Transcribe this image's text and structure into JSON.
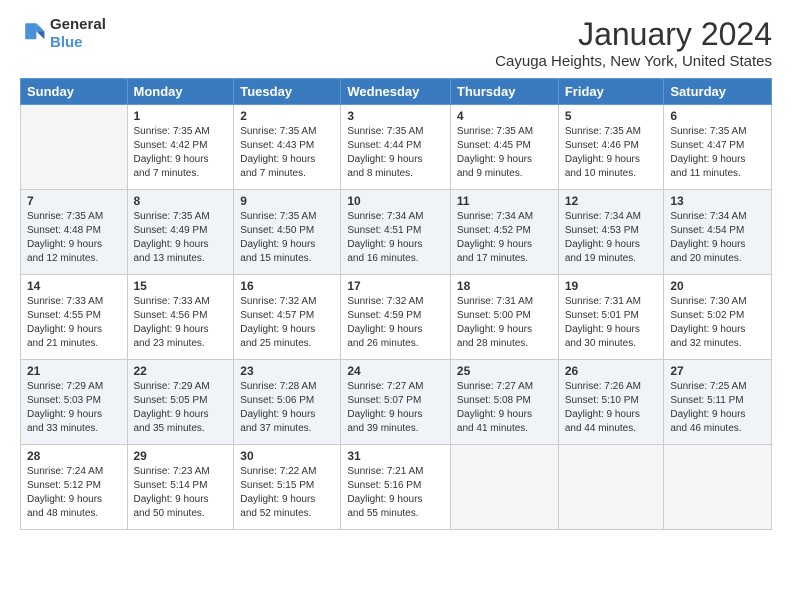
{
  "header": {
    "logo_line1": "General",
    "logo_line2": "Blue",
    "title": "January 2024",
    "subtitle": "Cayuga Heights, New York, United States"
  },
  "weekdays": [
    "Sunday",
    "Monday",
    "Tuesday",
    "Wednesday",
    "Thursday",
    "Friday",
    "Saturday"
  ],
  "weeks": [
    [
      {
        "day": "",
        "info": ""
      },
      {
        "day": "1",
        "info": "Sunrise: 7:35 AM\nSunset: 4:42 PM\nDaylight: 9 hours\nand 7 minutes."
      },
      {
        "day": "2",
        "info": "Sunrise: 7:35 AM\nSunset: 4:43 PM\nDaylight: 9 hours\nand 7 minutes."
      },
      {
        "day": "3",
        "info": "Sunrise: 7:35 AM\nSunset: 4:44 PM\nDaylight: 9 hours\nand 8 minutes."
      },
      {
        "day": "4",
        "info": "Sunrise: 7:35 AM\nSunset: 4:45 PM\nDaylight: 9 hours\nand 9 minutes."
      },
      {
        "day": "5",
        "info": "Sunrise: 7:35 AM\nSunset: 4:46 PM\nDaylight: 9 hours\nand 10 minutes."
      },
      {
        "day": "6",
        "info": "Sunrise: 7:35 AM\nSunset: 4:47 PM\nDaylight: 9 hours\nand 11 minutes."
      }
    ],
    [
      {
        "day": "7",
        "info": "Sunrise: 7:35 AM\nSunset: 4:48 PM\nDaylight: 9 hours\nand 12 minutes."
      },
      {
        "day": "8",
        "info": "Sunrise: 7:35 AM\nSunset: 4:49 PM\nDaylight: 9 hours\nand 13 minutes."
      },
      {
        "day": "9",
        "info": "Sunrise: 7:35 AM\nSunset: 4:50 PM\nDaylight: 9 hours\nand 15 minutes."
      },
      {
        "day": "10",
        "info": "Sunrise: 7:34 AM\nSunset: 4:51 PM\nDaylight: 9 hours\nand 16 minutes."
      },
      {
        "day": "11",
        "info": "Sunrise: 7:34 AM\nSunset: 4:52 PM\nDaylight: 9 hours\nand 17 minutes."
      },
      {
        "day": "12",
        "info": "Sunrise: 7:34 AM\nSunset: 4:53 PM\nDaylight: 9 hours\nand 19 minutes."
      },
      {
        "day": "13",
        "info": "Sunrise: 7:34 AM\nSunset: 4:54 PM\nDaylight: 9 hours\nand 20 minutes."
      }
    ],
    [
      {
        "day": "14",
        "info": "Sunrise: 7:33 AM\nSunset: 4:55 PM\nDaylight: 9 hours\nand 21 minutes."
      },
      {
        "day": "15",
        "info": "Sunrise: 7:33 AM\nSunset: 4:56 PM\nDaylight: 9 hours\nand 23 minutes."
      },
      {
        "day": "16",
        "info": "Sunrise: 7:32 AM\nSunset: 4:57 PM\nDaylight: 9 hours\nand 25 minutes."
      },
      {
        "day": "17",
        "info": "Sunrise: 7:32 AM\nSunset: 4:59 PM\nDaylight: 9 hours\nand 26 minutes."
      },
      {
        "day": "18",
        "info": "Sunrise: 7:31 AM\nSunset: 5:00 PM\nDaylight: 9 hours\nand 28 minutes."
      },
      {
        "day": "19",
        "info": "Sunrise: 7:31 AM\nSunset: 5:01 PM\nDaylight: 9 hours\nand 30 minutes."
      },
      {
        "day": "20",
        "info": "Sunrise: 7:30 AM\nSunset: 5:02 PM\nDaylight: 9 hours\nand 32 minutes."
      }
    ],
    [
      {
        "day": "21",
        "info": "Sunrise: 7:29 AM\nSunset: 5:03 PM\nDaylight: 9 hours\nand 33 minutes."
      },
      {
        "day": "22",
        "info": "Sunrise: 7:29 AM\nSunset: 5:05 PM\nDaylight: 9 hours\nand 35 minutes."
      },
      {
        "day": "23",
        "info": "Sunrise: 7:28 AM\nSunset: 5:06 PM\nDaylight: 9 hours\nand 37 minutes."
      },
      {
        "day": "24",
        "info": "Sunrise: 7:27 AM\nSunset: 5:07 PM\nDaylight: 9 hours\nand 39 minutes."
      },
      {
        "day": "25",
        "info": "Sunrise: 7:27 AM\nSunset: 5:08 PM\nDaylight: 9 hours\nand 41 minutes."
      },
      {
        "day": "26",
        "info": "Sunrise: 7:26 AM\nSunset: 5:10 PM\nDaylight: 9 hours\nand 44 minutes."
      },
      {
        "day": "27",
        "info": "Sunrise: 7:25 AM\nSunset: 5:11 PM\nDaylight: 9 hours\nand 46 minutes."
      }
    ],
    [
      {
        "day": "28",
        "info": "Sunrise: 7:24 AM\nSunset: 5:12 PM\nDaylight: 9 hours\nand 48 minutes."
      },
      {
        "day": "29",
        "info": "Sunrise: 7:23 AM\nSunset: 5:14 PM\nDaylight: 9 hours\nand 50 minutes."
      },
      {
        "day": "30",
        "info": "Sunrise: 7:22 AM\nSunset: 5:15 PM\nDaylight: 9 hours\nand 52 minutes."
      },
      {
        "day": "31",
        "info": "Sunrise: 7:21 AM\nSunset: 5:16 PM\nDaylight: 9 hours\nand 55 minutes."
      },
      {
        "day": "",
        "info": ""
      },
      {
        "day": "",
        "info": ""
      },
      {
        "day": "",
        "info": ""
      }
    ]
  ],
  "shaded_rows": [
    1,
    3
  ],
  "colors": {
    "header_bg": "#3a7abf",
    "shaded_row": "#f0f4f8",
    "empty_cell": "#f5f5f5",
    "empty_shaded": "#ebebeb"
  }
}
